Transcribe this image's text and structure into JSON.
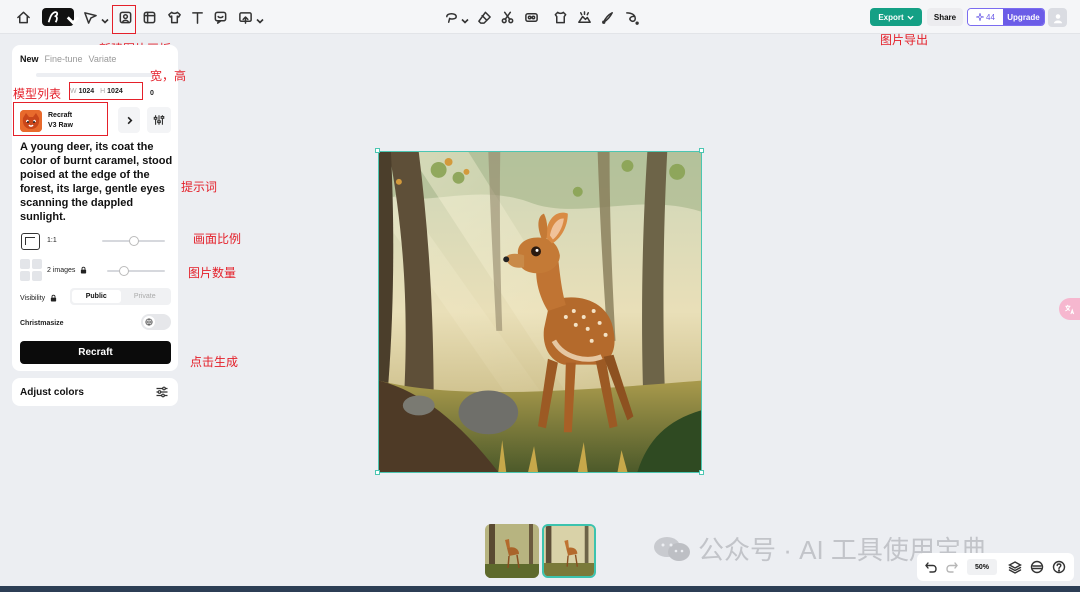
{
  "toolbar": {
    "left_icons": [
      "home-icon",
      "logo-button",
      "pointer-tool-icon",
      "new-frame-icon",
      "image-set-icon",
      "shirt-icon",
      "text-tool-icon",
      "comment-icon",
      "image-upload-icon"
    ],
    "center_icons": [
      "lasso-icon",
      "eraser-icon",
      "scissors-icon",
      "vectorize-icon",
      "mockup-icon",
      "remove-bg-icon",
      "inpaint-icon",
      "brush-icon"
    ],
    "export_label": "Export",
    "share_label": "Share",
    "credits": "44",
    "upgrade_label": "Upgrade"
  },
  "annotations": {
    "new_frame": "新建图片画板",
    "export": "图片导出",
    "size": "宽，高",
    "model_list": "模型列表",
    "prompt": "提示词",
    "ratio": "画面比例",
    "count": "图片数量",
    "generate": "点击生成"
  },
  "panel": {
    "tabs": [
      {
        "label": "New",
        "active": true
      },
      {
        "label": "Fine-tune",
        "active": false
      },
      {
        "label": "Variate",
        "active": false
      }
    ],
    "width_label": "W",
    "width_value": "1024",
    "height_label": "H",
    "height_value": "1024",
    "extra_value": "0",
    "model_name_line1": "Recraft",
    "model_name_line2": "V3 Raw",
    "prompt": "A young deer, its coat the color of burnt caramel, stood poised at the edge of the forest, its large, gentle eyes scanning the dappled sunlight.",
    "ratio_label": "1:1",
    "ratio_slider": 0.5,
    "images_label": "2 images",
    "images_slider": 0.3,
    "visibility_label": "Visibility",
    "visibility_options": [
      "Public",
      "Private"
    ],
    "visibility_selected": "Public",
    "christmasize_label": "Christmasize",
    "christmasize_on": false,
    "generate_label": "Recraft",
    "adjust_colors_label": "Adjust colors"
  },
  "zoom": {
    "value": "50%"
  },
  "watermark": "公众号 · AI 工具使用宝典",
  "colors": {
    "accent": "#14a085",
    "upgrade": "#6b5ce7",
    "annotation_red": "#e4202a",
    "selection": "#4cc6b2"
  }
}
